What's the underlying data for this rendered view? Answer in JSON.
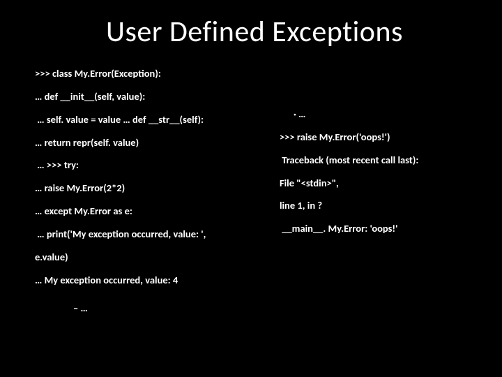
{
  "title": "User Defined Exceptions",
  "left": {
    "l1": ">>> class My.Error(Exception):",
    "l2": "… def __init__(self, value):",
    "l3": " … self. value = value … def __str__(self):",
    "l4": "… return repr(self. value)",
    "l5": " … >>> try:",
    "l6": "… raise My.Error(2*2)",
    "l7": "… except My.Error as e:",
    "l8": " … print('My exception occurred, value: ',",
    "l9": "e.value)",
    "l10": "… My exception occurred, value: 4",
    "l11": "–   …"
  },
  "right": {
    "r1": "· …",
    "r2": ">>> raise My.Error('oops!')",
    "r3": " Traceback (most recent call last):",
    "r4": "File \"<stdin>\",",
    "r5": "line 1, in ?",
    "r6": " __main__. My.Error: 'oops!'"
  }
}
